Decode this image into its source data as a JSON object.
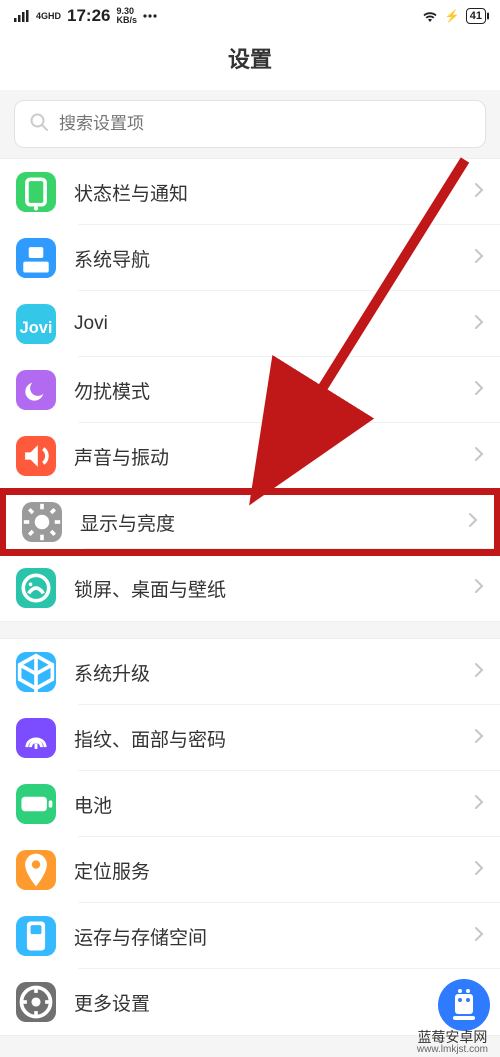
{
  "status": {
    "network_indicator": "4GHD",
    "time": "17:26",
    "speed_val": "9.30",
    "speed_unit": "KB/s",
    "battery": "41"
  },
  "header": {
    "title": "设置"
  },
  "search": {
    "placeholder": "搜索设置项"
  },
  "groups": [
    {
      "items": [
        {
          "key": "status-notif",
          "label": "状态栏与通知",
          "color": "ic-green"
        },
        {
          "key": "sys-nav",
          "label": "系统导航",
          "color": "ic-blue"
        },
        {
          "key": "jovi",
          "label": "Jovi",
          "color": "ic-jovi"
        },
        {
          "key": "dnd",
          "label": "勿扰模式",
          "color": "ic-purple"
        },
        {
          "key": "sound-vib",
          "label": "声音与振动",
          "color": "ic-red"
        },
        {
          "key": "display",
          "label": "显示与亮度",
          "color": "ic-gray",
          "highlight": true
        },
        {
          "key": "lock-wall",
          "label": "锁屏、桌面与壁纸",
          "color": "ic-teal"
        }
      ]
    },
    {
      "items": [
        {
          "key": "sys-update",
          "label": "系统升级",
          "color": "ic-sysup"
        },
        {
          "key": "biometrics",
          "label": "指纹、面部与密码",
          "color": "ic-finger"
        },
        {
          "key": "battery",
          "label": "电池",
          "color": "ic-batt"
        },
        {
          "key": "location",
          "label": "定位服务",
          "color": "ic-loc"
        },
        {
          "key": "storage",
          "label": "运存与存储空间",
          "color": "ic-store"
        },
        {
          "key": "more",
          "label": "更多设置",
          "color": "ic-more"
        }
      ]
    }
  ],
  "watermark": {
    "title": "蓝莓安卓网",
    "url": "www.lmkjst.com"
  }
}
